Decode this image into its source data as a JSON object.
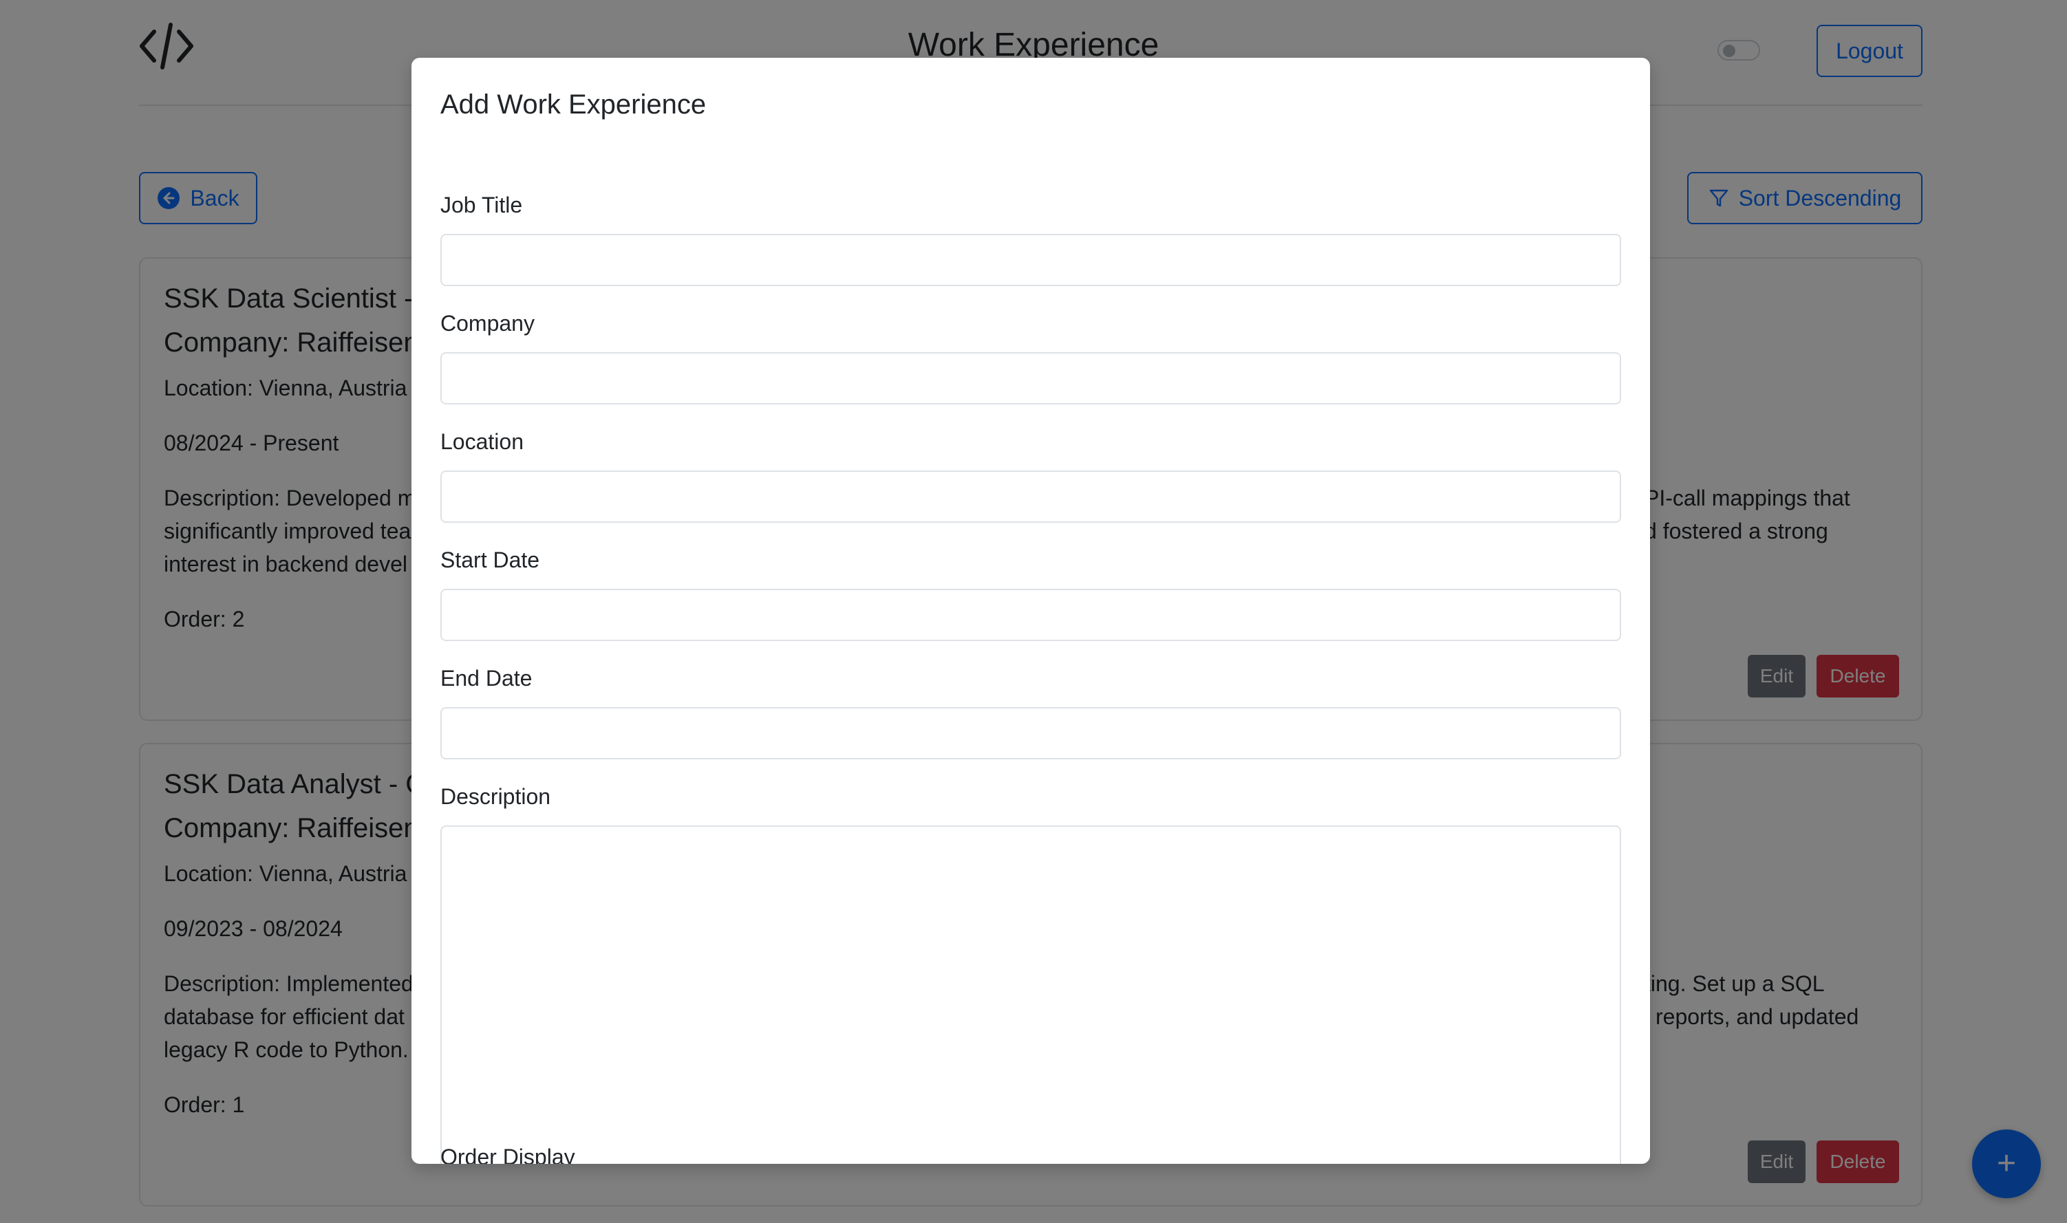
{
  "header": {
    "logo_icon": "code-brackets-icon",
    "title": "Work Experience",
    "logout_label": "Logout"
  },
  "toolbar": {
    "back_label": "Back",
    "back_icon": "arrow-left-circle-icon",
    "sort_label": "Sort Descending",
    "sort_icon": "funnel-icon"
  },
  "cards": [
    {
      "title": "SSK Data Scientist - ",
      "company": "Company: Raiffeisen",
      "location": "Location: Vienna, Austria",
      "dates": "08/2024 - Present",
      "description_left": "Description: Developed m\nsignificantly improved tea\ninterest in backend devel",
      "description_right": "PI-call mappings that\nd fostered a strong",
      "order": "Order: 2",
      "edit_label": "Edit",
      "delete_label": "Delete"
    },
    {
      "title": "SSK Data Analyst - C",
      "company": "Company: Raiffeisen",
      "location": "Location: Vienna, Austria",
      "dates": "09/2023 - 08/2024",
      "description_left": "Description: Implemented\ndatabase for efficient dat\nlegacy R code to Python.",
      "description_right": "ting. Set up a SQL\nl reports, and updated",
      "order": "Order: 1",
      "edit_label": "Edit",
      "delete_label": "Delete"
    }
  ],
  "fab": {
    "icon": "plus-icon",
    "symbol": "+"
  },
  "modal": {
    "title": "Add Work Experience",
    "fields": {
      "job_title": {
        "label": "Job Title",
        "value": ""
      },
      "company": {
        "label": "Company",
        "value": ""
      },
      "location": {
        "label": "Location",
        "value": ""
      },
      "start_date": {
        "label": "Start Date",
        "value": ""
      },
      "end_date": {
        "label": "End Date",
        "value": ""
      },
      "description": {
        "label": "Description",
        "value": ""
      },
      "order_display": {
        "label": "Order Display"
      }
    }
  },
  "colors": {
    "primary": "#0d6efd",
    "secondary": "#6c757d",
    "danger": "#dc3545",
    "overlay": "rgba(0,0,0,0.5)"
  }
}
